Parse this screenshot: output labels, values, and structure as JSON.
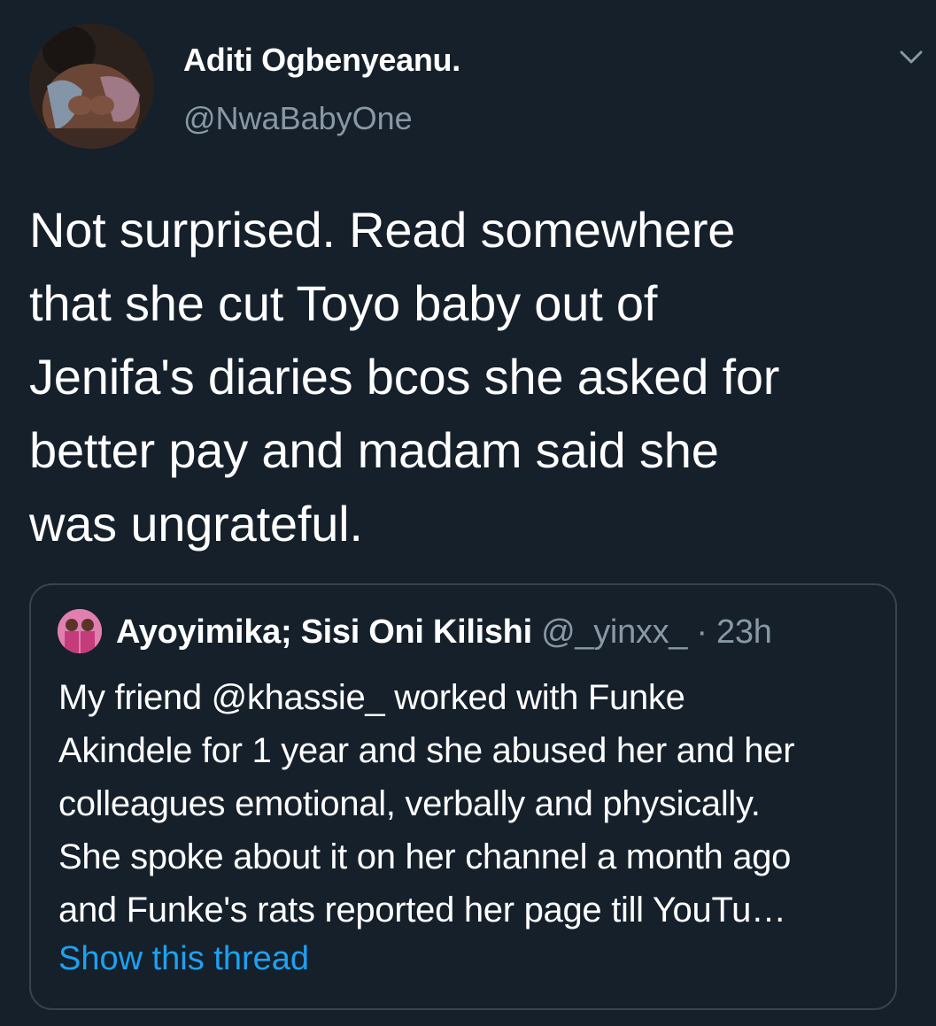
{
  "author": {
    "name": "Aditi Ogbenyeanu.",
    "handle": "@NwaBabyOne",
    "avatar_icon": "profile-photo"
  },
  "menu": {
    "icon": "chevron-down-icon"
  },
  "tweet": {
    "text": "Not surprised. Read somewhere\nthat she cut Toyo baby out of\nJenifa's diaries bcos she asked for\nbetter pay and madam said she\nwas ungrateful."
  },
  "quoted_tweet": {
    "name": "Ayoyimika; Sisi Oni Kilishi",
    "handle": "@_yinxx_",
    "separator": "·",
    "time": "23h",
    "text": "My friend @khassie_ worked with Funke\nAkindele for 1 year and she abused her and her\ncolleagues emotional, verbally and physically.\nShe spoke about it on her channel a month ago\nand Funke's rats reported her page till YouTu…",
    "show_thread_label": "Show this thread",
    "avatar_icon": "profile-photo"
  },
  "colors": {
    "background": "#15202b",
    "primary_text": "#ffffff",
    "secondary_text": "#8899a6",
    "link": "#1da1f2",
    "border": "#38444d"
  }
}
